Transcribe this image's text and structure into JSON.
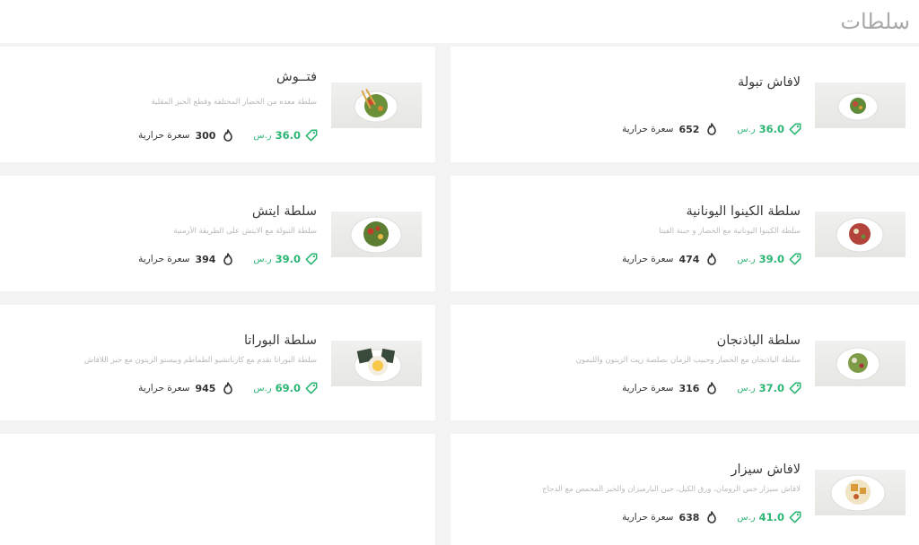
{
  "section": {
    "title": "سلطات"
  },
  "currency": "ر.س",
  "calories_label": "سعرة حرارية",
  "colors": {
    "accent": "#2bb673",
    "title": "#a8a8a8"
  },
  "items": [
    {
      "name": "لافاش تبولة",
      "desc": "",
      "price": "36.0",
      "calories": "652"
    },
    {
      "name": "فتــوش",
      "desc": "سلطة معده من الخضار المختلفة وقطع الخبز المقلية",
      "price": "36.0",
      "calories": "300"
    },
    {
      "name": "سلطة الكينوا اليونانية",
      "desc": "سلطة الكينوا اليونانية مع الخضار و جبنة الفيتا",
      "price": "39.0",
      "calories": "474"
    },
    {
      "name": "سلطة ايتش",
      "desc": "سلطة التبولة مع الايتش على الطريقة الأرمنية",
      "price": "39.0",
      "calories": "394"
    },
    {
      "name": "سلطة الباذنجان",
      "desc": "سلطة الباذنجان مع الخضار وحبيب الرمان بصلصة زيت الزيتون والليمون",
      "price": "37.0",
      "calories": "316"
    },
    {
      "name": "سلطة البوراتا",
      "desc": "سلطة البوراتا تقدم مع كارباتشيو الطماطم وبيستو الزيتون مع خبز اللافاش",
      "price": "69.0",
      "calories": "945"
    },
    {
      "name": "لافاش سيزار",
      "desc": "لافاش سيزار خس الرومان، ورق الكيل، جبن البارميزان والخبز المحمص مع الدجاج",
      "price": "41.0",
      "calories": "638"
    }
  ]
}
